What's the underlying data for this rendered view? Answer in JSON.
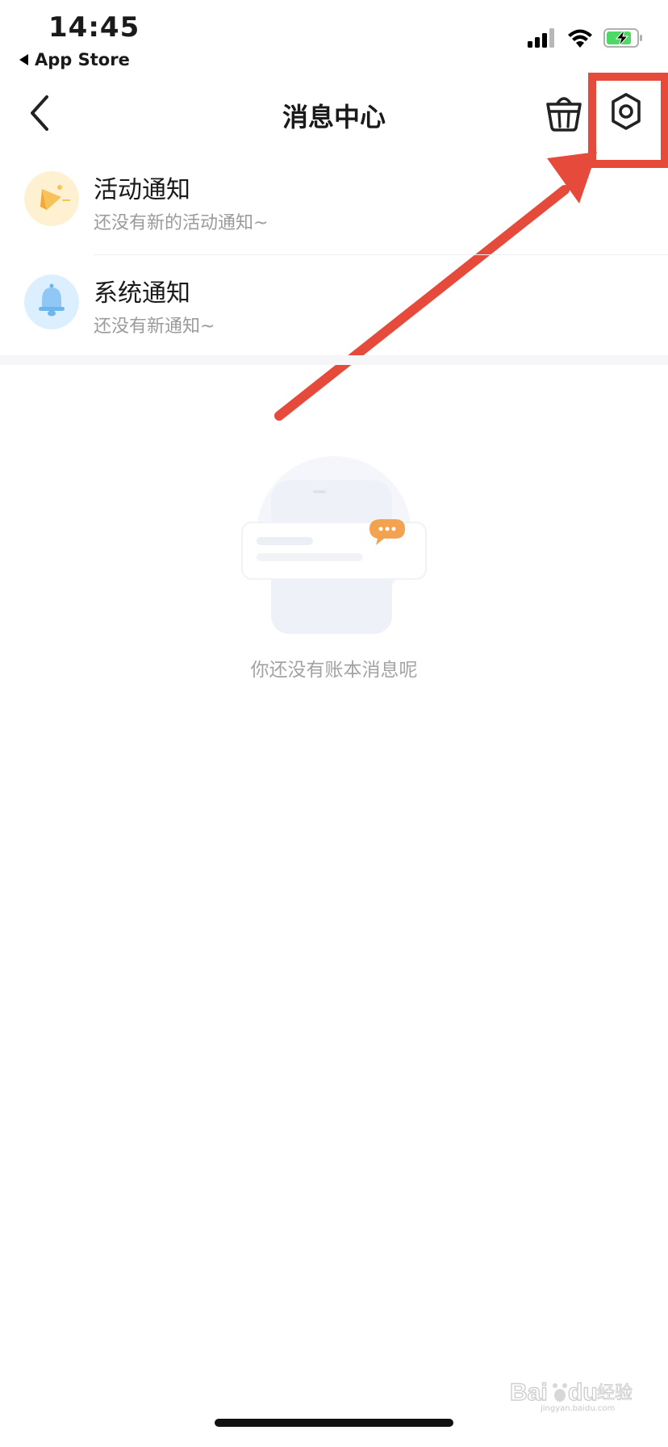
{
  "status_bar": {
    "time": "14:45",
    "back_app": "App Store"
  },
  "nav": {
    "title": "消息中心"
  },
  "messages": [
    {
      "title": "活动通知",
      "subtitle": "还没有新的活动通知~"
    },
    {
      "title": "系统通知",
      "subtitle": "还没有新通知~"
    }
  ],
  "empty_state": {
    "text": "你还没有账本消息呢"
  },
  "watermark": {
    "text": "Baidu经验",
    "sub": "jingyan.baidu.com"
  },
  "colors": {
    "annotation_red": "#e64a3b",
    "activity_icon": "#f7c25a",
    "system_icon": "#6cb6f0",
    "battery_green": "#4cd964"
  }
}
